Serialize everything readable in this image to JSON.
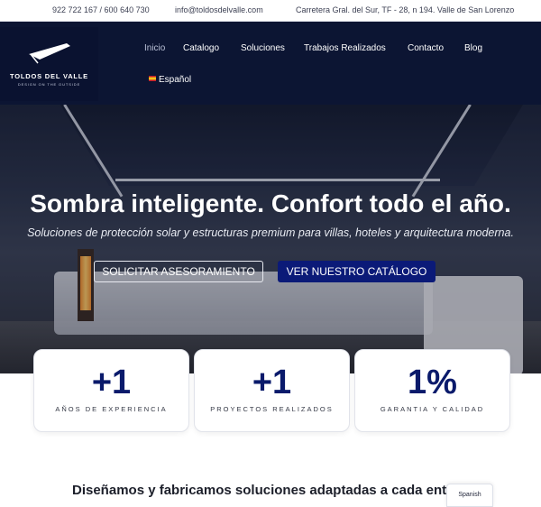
{
  "topbar": {
    "phone": "922 722 167 / 600 640 730",
    "email": "info@toldosdelvalle.com",
    "address": "Carretera Gral. del Sur, TF - 28, n 194. Valle de San Lorenzo"
  },
  "logo": {
    "name": "TOLDOS DEL VALLE",
    "tagline": "DESIGN ON THE OUTSIDE"
  },
  "nav": {
    "items": [
      "Inicio",
      "Catalogo",
      "Soluciones",
      "Trabajos Realizados",
      "Contacto",
      "Blog"
    ],
    "language": "Español"
  },
  "hero": {
    "title": "Sombra inteligente. Confort todo el año.",
    "subtitle": "Soluciones de protección solar y estructuras premium para villas, hoteles y arquitectura moderna.",
    "cta_primary": "SOLICITAR ASESORAMIENTO",
    "cta_secondary": "VER NUESTRO CATÁLOGO"
  },
  "stats": [
    {
      "value": "+1",
      "label": "AÑOS DE EXPERIENCIA"
    },
    {
      "value": "+1",
      "label": "PROYECTOS REALIZADOS"
    },
    {
      "value": "1%",
      "label": "GARANTIA Y CALIDAD"
    }
  ],
  "intro": {
    "text": "Diseñamos y fabricamos soluciones adaptadas a cada ent"
  },
  "language_widget": {
    "label": "Spanish"
  },
  "colors": {
    "header_bg": "#0c1533",
    "accent": "#0b1a78",
    "stat_number": "#0a1a6b"
  }
}
